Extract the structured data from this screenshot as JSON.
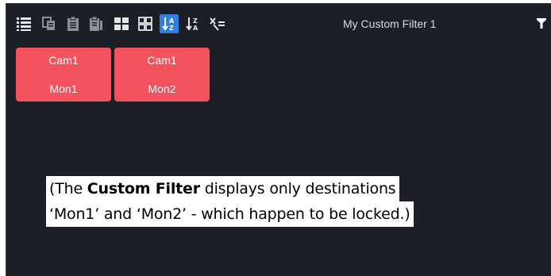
{
  "toolbar": {
    "icons": [
      {
        "name": "list-view-icon"
      },
      {
        "name": "copy-icon"
      },
      {
        "name": "clipboard-icon"
      },
      {
        "name": "clipboard-list-icon"
      },
      {
        "name": "grid-large-icon"
      },
      {
        "name": "grid-small-icon"
      },
      {
        "name": "sort-ascending-icon",
        "active": true
      },
      {
        "name": "sort-descending-icon"
      },
      {
        "name": "clear-filter-icon"
      }
    ],
    "accent_color": "#2f7fe0"
  },
  "filter": {
    "selected": "My Custom Filter 1"
  },
  "tiles": [
    {
      "source": "Cam1",
      "destination": "Mon1",
      "color": "#f2525d"
    },
    {
      "source": "Cam1",
      "destination": "Mon2",
      "color": "#f2525d"
    }
  ],
  "caption": {
    "prefix": "(The ",
    "bold": "Custom Filter",
    "suffix": " displays only destinations",
    "line2": "‘Mon1’ and ‘Mon2’ - which happen to be locked.)"
  }
}
